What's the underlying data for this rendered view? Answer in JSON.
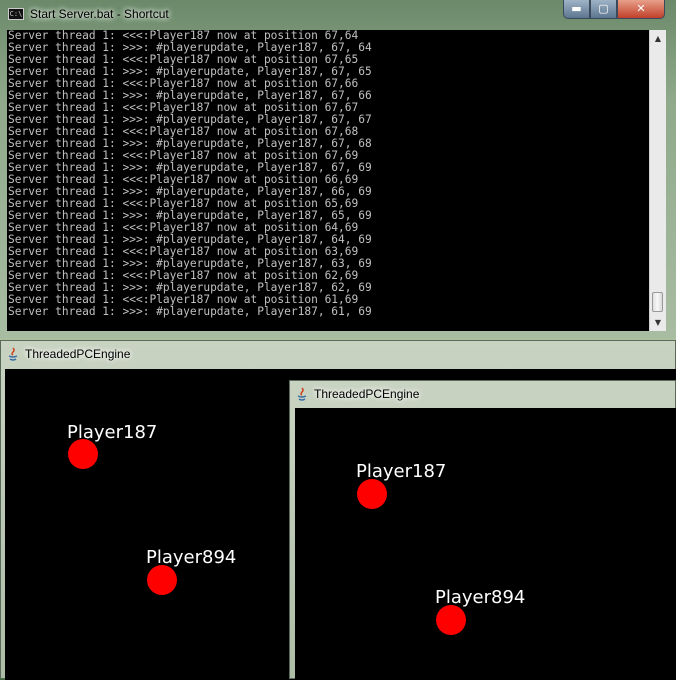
{
  "console": {
    "title": "Start Server.bat - Shortcut",
    "icon_text": "C:\\",
    "controls": {
      "minimize": "▬",
      "maximize": "▢",
      "close": "✕"
    },
    "lines": [
      "Server thread 1: <<<:Player187 now at position 67,64",
      "Server thread 1: >>>: #playerupdate, Player187, 67, 64",
      "Server thread 1: <<<:Player187 now at position 67,65",
      "Server thread 1: >>>: #playerupdate, Player187, 67, 65",
      "Server thread 1: <<<:Player187 now at position 67,66",
      "Server thread 1: >>>: #playerupdate, Player187, 67, 66",
      "Server thread 1: <<<:Player187 now at position 67,67",
      "Server thread 1: >>>: #playerupdate, Player187, 67, 67",
      "Server thread 1: <<<:Player187 now at position 67,68",
      "Server thread 1: >>>: #playerupdate, Player187, 67, 68",
      "Server thread 1: <<<:Player187 now at position 67,69",
      "Server thread 1: >>>: #playerupdate, Player187, 67, 69",
      "Server thread 1: <<<:Player187 now at position 66,69",
      "Server thread 1: >>>: #playerupdate, Player187, 66, 69",
      "Server thread 1: <<<:Player187 now at position 65,69",
      "Server thread 1: >>>: #playerupdate, Player187, 65, 69",
      "Server thread 1: <<<:Player187 now at position 64,69",
      "Server thread 1: >>>: #playerupdate, Player187, 64, 69",
      "Server thread 1: <<<:Player187 now at position 63,69",
      "Server thread 1: >>>: #playerupdate, Player187, 63, 69",
      "Server thread 1: <<<:Player187 now at position 62,69",
      "Server thread 1: >>>: #playerupdate, Player187, 62, 69",
      "Server thread 1: <<<:Player187 now at position 61,69",
      "Server thread 1: >>>: #playerupdate, Player187, 61, 69"
    ],
    "colors": {
      "background": "#000000",
      "text": "#c0c0c0"
    }
  },
  "client_window_1": {
    "title": "ThreadedPCEngine",
    "icon": "java-icon",
    "players": [
      {
        "name": "Player187"
      },
      {
        "name": "Player894"
      }
    ]
  },
  "client_window_2": {
    "title": "ThreadedPCEngine",
    "icon": "java-icon",
    "players": [
      {
        "name": "Player187"
      },
      {
        "name": "Player894"
      }
    ]
  },
  "colors": {
    "player_dot": "#ff0000",
    "canvas": "#000000",
    "label": "#ffffff"
  }
}
